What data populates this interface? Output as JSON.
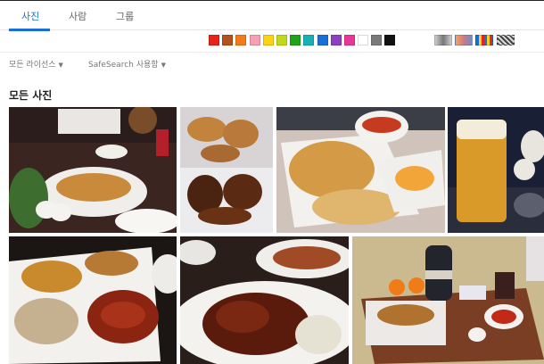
{
  "tabs": [
    {
      "label": "사진",
      "active": true
    },
    {
      "label": "사람",
      "active": false
    },
    {
      "label": "그룹",
      "active": false
    }
  ],
  "color_filter": {
    "swatches": [
      "#e8231b",
      "#b3521a",
      "#f47c18",
      "#f6a0b0",
      "#fbd214",
      "#c2d81c",
      "#1ea319",
      "#19b0b4",
      "#1a6fd6",
      "#8e3fc4",
      "#e7389a",
      "#ffffff",
      "#7a7a7a",
      "#111111"
    ],
    "modes": [
      "grayscale",
      "color",
      "pattern",
      "noise"
    ]
  },
  "filters": {
    "license": "모든 라이선스",
    "safesearch": "SafeSearch 사용함"
  },
  "section": {
    "title": "모든 사진"
  },
  "photos": [
    {
      "name": "fried-chicken-table-photo"
    },
    {
      "name": "chicken-boxes-photo"
    },
    {
      "name": "fried-food-platter-photo"
    },
    {
      "name": "beer-glass-photo"
    },
    {
      "name": "spicy-chicken-plate-photo"
    },
    {
      "name": "glazed-wings-photo"
    },
    {
      "name": "chicken-delivery-table-photo"
    }
  ]
}
